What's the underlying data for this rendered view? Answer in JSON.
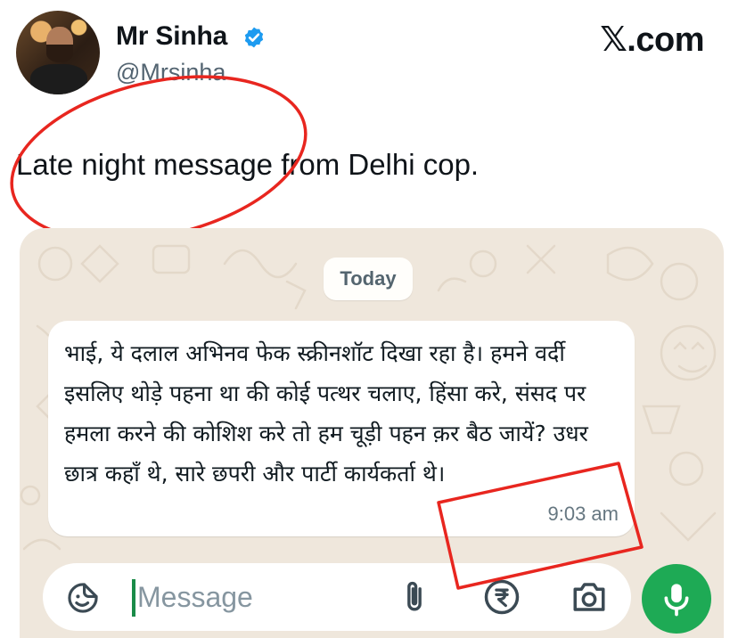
{
  "tweet": {
    "author_name": "Mr Sinha",
    "author_handle": "@Mrsinha",
    "verified": true,
    "site_brand": "𝕏.com",
    "text": "Late night message from Delhi cop."
  },
  "chat": {
    "date_label": "Today",
    "message": {
      "text": "भाई, ये दलाल अभिनव फेक स्क्रीनशॉट दिखा रहा है। हमने वर्दी इसलिए थोड़े पहना था की कोई पत्थर चलाए, हिंसा करे, संसद पर हमला करने की कोशिश करे तो हम चूड़ी पहन क़र बैठ जायें? उधर छात्र कहाँ थे, सारे छपरी और पार्टी कार्यकर्ता थे।",
      "time": "9:03 am"
    },
    "input": {
      "placeholder": "Message"
    },
    "icons": {
      "sticker": "sticker-smiley-icon",
      "attach": "paperclip-icon",
      "payment": "rupee-icon",
      "camera": "camera-icon",
      "mic": "microphone-icon"
    }
  },
  "colors": {
    "verified_blue": "#1d9bf0",
    "annotation_red": "#e8261f",
    "whatsapp_green": "#1eaa55",
    "chat_background": "#efe7dc"
  }
}
